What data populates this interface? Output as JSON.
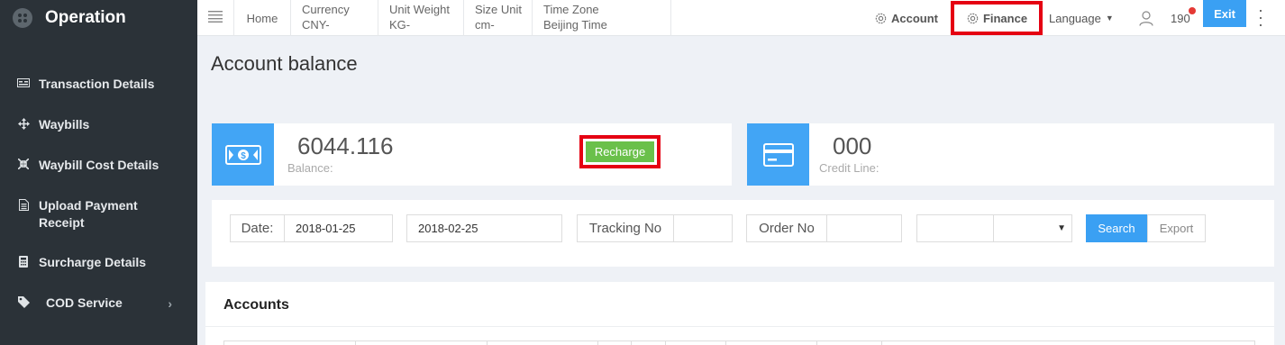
{
  "sidebar": {
    "title": "Operation",
    "items": [
      {
        "label": "Transaction Details",
        "icon": "card-icon"
      },
      {
        "label": "Waybills",
        "icon": "move-icon"
      },
      {
        "label": "Waybill Cost Details",
        "icon": "compress-icon"
      },
      {
        "label": "Upload Payment Receipt",
        "icon": "file-icon"
      },
      {
        "label": "Surcharge Details",
        "icon": "calculator-icon"
      },
      {
        "label": "COD Service",
        "icon": "tag-icon"
      }
    ]
  },
  "topbar": {
    "home": "Home",
    "currency_label": "Currency",
    "currency_value": "CNY-",
    "weight_label": "Unit Weight",
    "weight_value": "KG-",
    "size_label": "Size Unit",
    "size_value": "cm-",
    "timezone_label": "Time Zone",
    "timezone_value": "Beijing Time",
    "account": "Account",
    "finance": "Finance",
    "language": "Language",
    "user_number": "190",
    "exit": "Exit"
  },
  "page": {
    "title": "Account balance"
  },
  "balance_card": {
    "value": "6044.116",
    "label": "Balance:",
    "recharge": "Recharge"
  },
  "credit_card": {
    "value": "000",
    "label": "Credit Line:"
  },
  "filters": {
    "date_label": "Date:",
    "date_from": "2018-01-25",
    "date_to": "2018-02-25",
    "tracking_label": "Tracking No",
    "tracking_value": "",
    "order_label": "Order No",
    "order_value": "",
    "search": "Search",
    "export": "Export"
  },
  "accounts": {
    "title": "Accounts"
  },
  "colors": {
    "sidebar_bg": "#2b3238",
    "accent_blue": "#3aa0f3",
    "recharge_green": "#6ac04a",
    "highlight_red": "#e50012"
  }
}
